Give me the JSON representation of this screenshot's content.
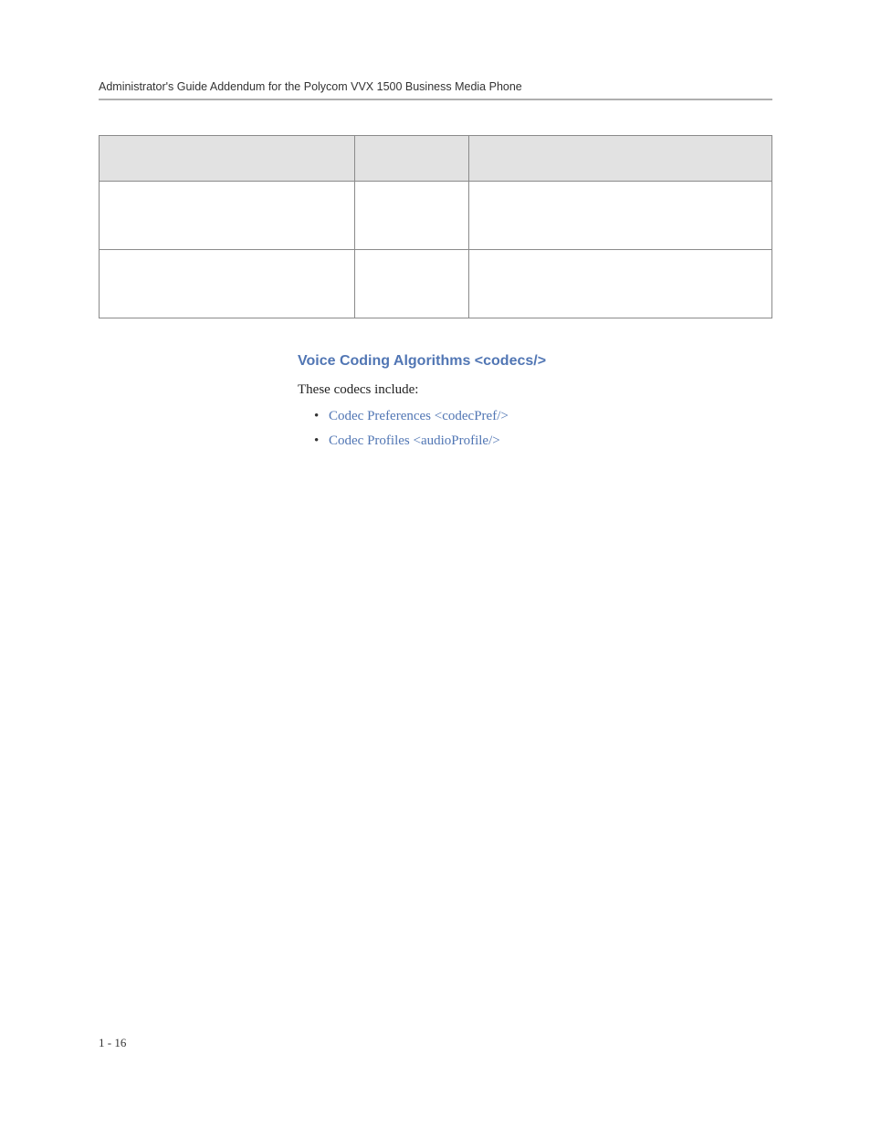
{
  "header": {
    "title": "Administrator's Guide Addendum for the Polycom VVX 1500 Business Media Phone"
  },
  "table": {
    "headers": [
      "",
      "",
      ""
    ],
    "rows": [
      [
        "",
        "",
        ""
      ],
      [
        "",
        "",
        ""
      ]
    ]
  },
  "section": {
    "heading": "Voice Coding Algorithms <codecs/>",
    "intro": "These codecs include:",
    "bullets": [
      "Codec Preferences <codecPref/>",
      "Codec Profiles <audioProfile/>"
    ]
  },
  "footer": {
    "pageNumber": "1 - 16"
  }
}
